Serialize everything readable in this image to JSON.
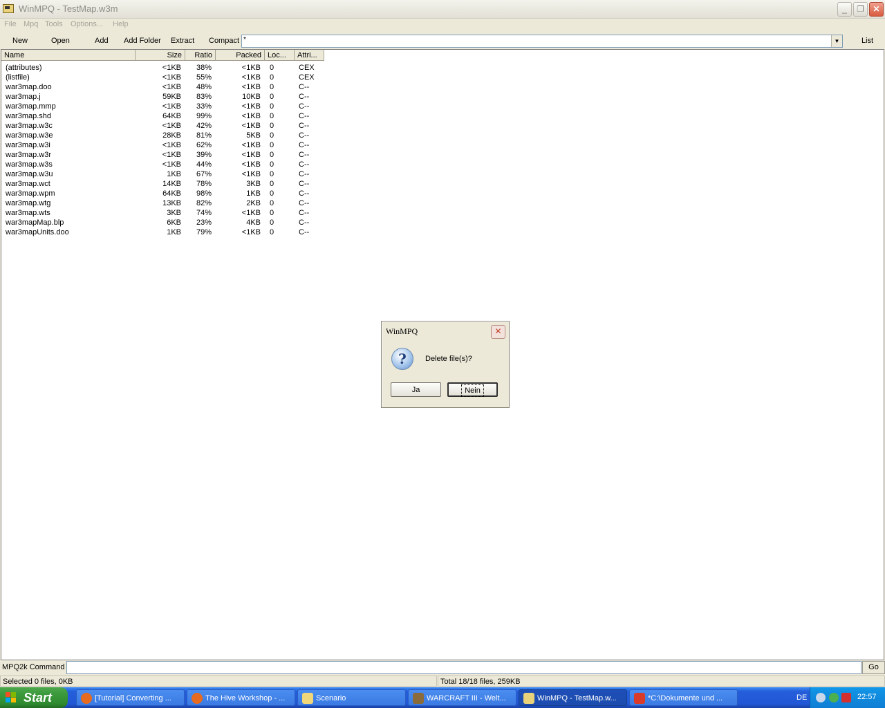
{
  "window": {
    "title": "WinMPQ - TestMap.w3m"
  },
  "menu": [
    "File",
    "Mpq",
    "Tools",
    "Options...",
    "Help"
  ],
  "toolbar": {
    "buttons": [
      "New",
      "Open",
      "Add",
      "Add Folder",
      "Extract",
      "Compact"
    ],
    "filter_value": "*",
    "list_label": "List"
  },
  "columns": [
    "Name",
    "Size",
    "Ratio",
    "Packed",
    "Loc...",
    "Attri..."
  ],
  "files": [
    {
      "name": "(attributes)",
      "size": "<1KB",
      "ratio": "38%",
      "packed": "<1KB",
      "loc": "0",
      "attr": "CEX"
    },
    {
      "name": "(listfile)",
      "size": "<1KB",
      "ratio": "55%",
      "packed": "<1KB",
      "loc": "0",
      "attr": "CEX"
    },
    {
      "name": "war3map.doo",
      "size": "<1KB",
      "ratio": "48%",
      "packed": "<1KB",
      "loc": "0",
      "attr": "C--"
    },
    {
      "name": "war3map.j",
      "size": "59KB",
      "ratio": "83%",
      "packed": "10KB",
      "loc": "0",
      "attr": "C--"
    },
    {
      "name": "war3map.mmp",
      "size": "<1KB",
      "ratio": "33%",
      "packed": "<1KB",
      "loc": "0",
      "attr": "C--"
    },
    {
      "name": "war3map.shd",
      "size": "64KB",
      "ratio": "99%",
      "packed": "<1KB",
      "loc": "0",
      "attr": "C--"
    },
    {
      "name": "war3map.w3c",
      "size": "<1KB",
      "ratio": "42%",
      "packed": "<1KB",
      "loc": "0",
      "attr": "C--"
    },
    {
      "name": "war3map.w3e",
      "size": "28KB",
      "ratio": "81%",
      "packed": "5KB",
      "loc": "0",
      "attr": "C--"
    },
    {
      "name": "war3map.w3i",
      "size": "<1KB",
      "ratio": "62%",
      "packed": "<1KB",
      "loc": "0",
      "attr": "C--"
    },
    {
      "name": "war3map.w3r",
      "size": "<1KB",
      "ratio": "39%",
      "packed": "<1KB",
      "loc": "0",
      "attr": "C--"
    },
    {
      "name": "war3map.w3s",
      "size": "<1KB",
      "ratio": "44%",
      "packed": "<1KB",
      "loc": "0",
      "attr": "C--"
    },
    {
      "name": "war3map.w3u",
      "size": "1KB",
      "ratio": "67%",
      "packed": "<1KB",
      "loc": "0",
      "attr": "C--"
    },
    {
      "name": "war3map.wct",
      "size": "14KB",
      "ratio": "78%",
      "packed": "3KB",
      "loc": "0",
      "attr": "C--"
    },
    {
      "name": "war3map.wpm",
      "size": "64KB",
      "ratio": "98%",
      "packed": "1KB",
      "loc": "0",
      "attr": "C--"
    },
    {
      "name": "war3map.wtg",
      "size": "13KB",
      "ratio": "82%",
      "packed": "2KB",
      "loc": "0",
      "attr": "C--"
    },
    {
      "name": "war3map.wts",
      "size": "3KB",
      "ratio": "74%",
      "packed": "<1KB",
      "loc": "0",
      "attr": "C--"
    },
    {
      "name": "war3mapMap.blp",
      "size": "6KB",
      "ratio": "23%",
      "packed": "4KB",
      "loc": "0",
      "attr": "C--"
    },
    {
      "name": "war3mapUnits.doo",
      "size": "1KB",
      "ratio": "79%",
      "packed": "<1KB",
      "loc": "0",
      "attr": "C--"
    }
  ],
  "command": {
    "label": "MPQ2k Command",
    "go_label": "Go"
  },
  "status": {
    "selected": "Selected 0 files, 0KB",
    "total": "Total 18/18 files, 259KB"
  },
  "dialog": {
    "title": "WinMPQ",
    "message": "Delete file(s)?",
    "yes_label": "Ja",
    "no_label": "Nein",
    "icon": "question-icon"
  },
  "taskbar": {
    "start_label": "Start",
    "tasks": [
      {
        "label": "[Tutorial] Converting ...",
        "icon": "firefox-icon"
      },
      {
        "label": "The Hive Workshop - ...",
        "icon": "firefox-icon"
      },
      {
        "label": "Scenario",
        "icon": "folder-icon"
      },
      {
        "label": "WARCRAFT III - Welt...",
        "icon": "warcraft-icon"
      },
      {
        "label": "WinMPQ - TestMap.w...",
        "icon": "winmpq-icon",
        "active": true
      },
      {
        "label": "*C:\\Dokumente und ...",
        "icon": "editor-icon"
      }
    ],
    "language": "DE",
    "clock": "22:57"
  }
}
